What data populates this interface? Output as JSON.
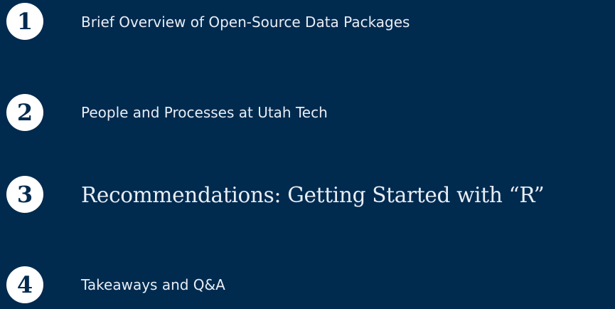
{
  "agenda": {
    "items": [
      {
        "number": "1",
        "label": "Brief Overview of Open-Source Data Packages",
        "highlighted": false
      },
      {
        "number": "2",
        "label": "People and Processes at Utah Tech",
        "highlighted": false
      },
      {
        "number": "3",
        "label": "Recommendations: Getting Started with “R”",
        "highlighted": true
      },
      {
        "number": "4",
        "label": "Takeaways and Q&A",
        "highlighted": false
      }
    ]
  },
  "colors": {
    "background": "#012a4f",
    "badge_fill": "#ffffff",
    "badge_text": "#012a4f",
    "text": "#e8eef5"
  }
}
